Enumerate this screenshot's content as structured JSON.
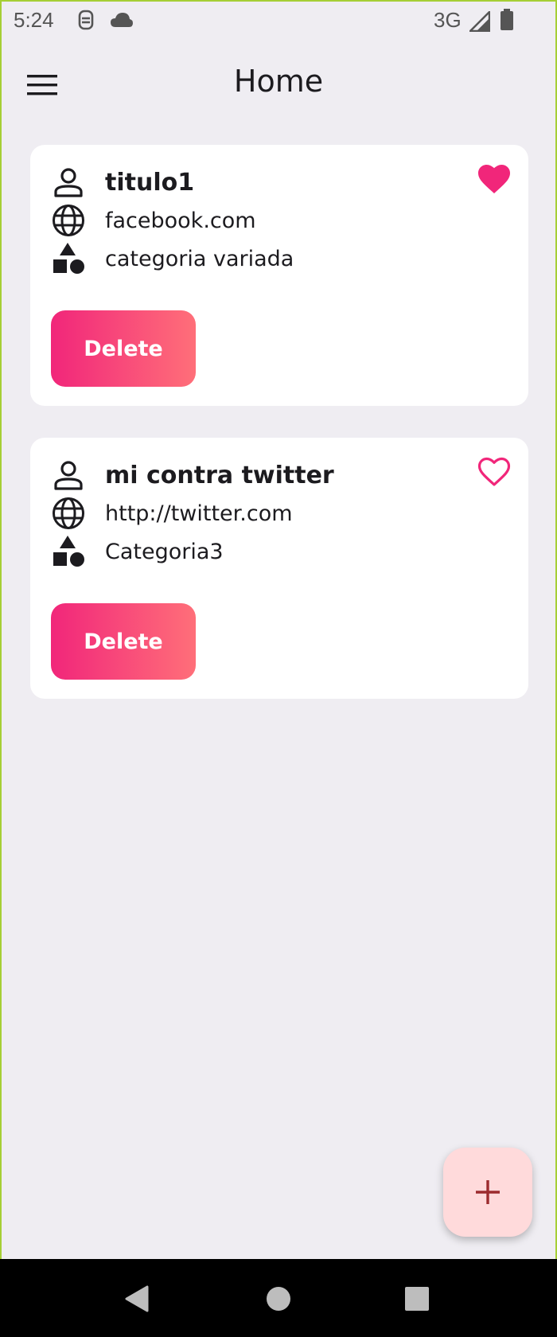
{
  "status_bar": {
    "time": "5:24",
    "network": "3G",
    "icons": [
      "sim-icon",
      "cloud-icon",
      "signal-icon",
      "battery-icon"
    ]
  },
  "app_bar": {
    "title": "Home",
    "menu_icon": "menu-icon"
  },
  "colors": {
    "background": "#efedf2",
    "card": "#ffffff",
    "accent_pink": "#f1267a",
    "gradient_end": "#ff6f79",
    "fab_bg": "#ffdadb",
    "fab_icon": "#9c2b2e"
  },
  "entries": [
    {
      "title": "titulo1",
      "site": "facebook.com",
      "category": "categoria variada",
      "favorite": true,
      "delete_label": "Delete"
    },
    {
      "title": "mi contra twitter",
      "site": "http://twitter.com",
      "category": "Categoria3",
      "favorite": false,
      "delete_label": "Delete"
    }
  ],
  "fab": {
    "icon": "plus-icon"
  },
  "nav_bar": {
    "icons": [
      "back-icon",
      "home-icon",
      "recents-icon"
    ]
  }
}
